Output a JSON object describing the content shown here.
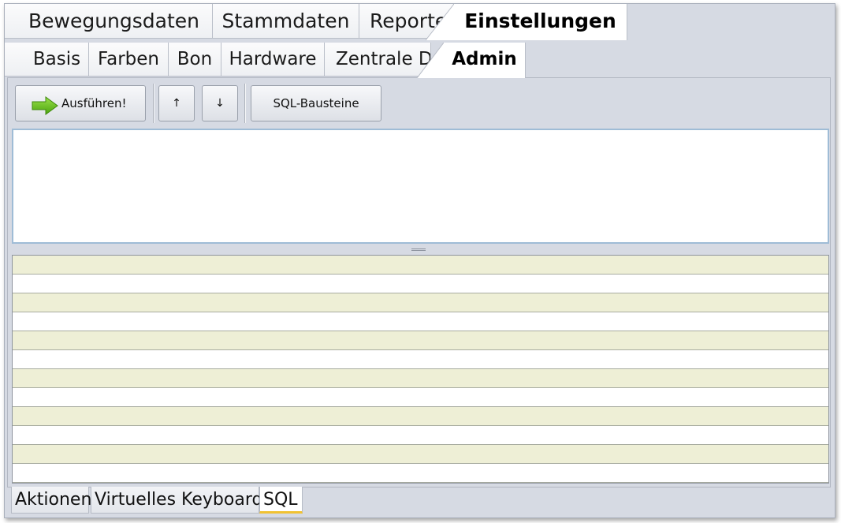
{
  "main_tabs": {
    "items": [
      "Bewegungsdaten",
      "Stammdaten",
      "Reporte",
      "Einstellungen"
    ],
    "active": "Einstellungen"
  },
  "sub_tabs": {
    "items": [
      "Basis",
      "Farben",
      "Bon",
      "Hardware",
      "Zentrale DP",
      "Admin"
    ],
    "active": "Admin"
  },
  "toolbar": {
    "execute_label": "Ausführen!",
    "execute_icon": "green-right-arrow-icon",
    "up_label": "↑",
    "down_label": "↓",
    "sql_blocks_label": "SQL-Bausteine"
  },
  "editor": {
    "value": ""
  },
  "results": {
    "row_count": 12
  },
  "bottom_tabs": {
    "items": [
      "Aktionen",
      "Virtuelles Keyboard",
      "SQL"
    ],
    "active": "SQL"
  },
  "colors": {
    "row_alt": "#eeefd6",
    "active_tab_underline": "#f1c232",
    "execute_arrow": "#5fc217"
  }
}
